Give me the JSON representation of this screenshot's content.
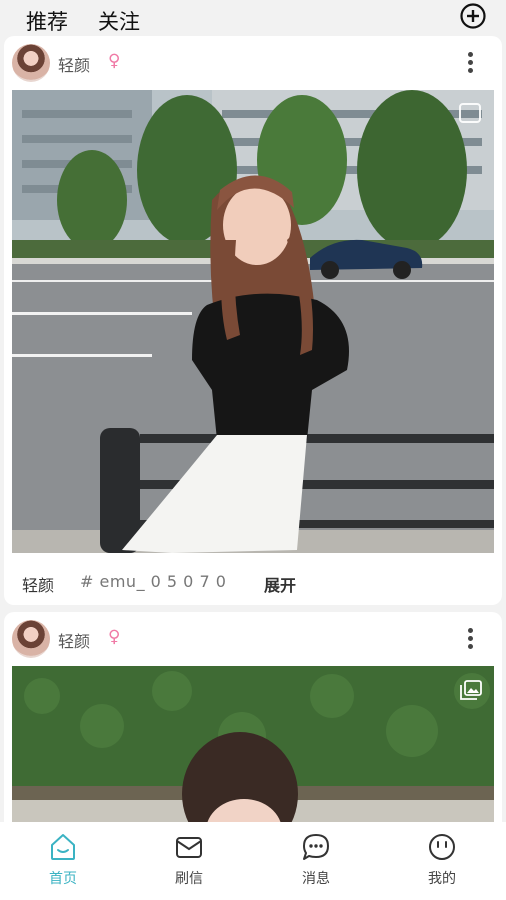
{
  "topbar": {
    "tab_recommend": "推荐",
    "tab_follow": "关注",
    "add_icon": "plus-circle-icon"
  },
  "posts": [
    {
      "username": "轻颜",
      "gender_symbol": "♀",
      "caption_name": "轻颜",
      "caption_tag": "# emu_ 0 5 0 7 0",
      "expand_label": "展开"
    },
    {
      "username": "轻颜",
      "gender_symbol": "♀"
    }
  ],
  "bottom_nav": {
    "items": [
      {
        "label": "首页",
        "icon": "home-icon",
        "active": true
      },
      {
        "label": "刷信",
        "icon": "envelope-icon",
        "active": false
      },
      {
        "label": "消息",
        "icon": "chat-bubble-icon",
        "active": false
      },
      {
        "label": "我的",
        "icon": "smiley-face-icon",
        "active": false
      }
    ]
  },
  "colors": {
    "accent": "#3bb3c3",
    "gender_pink": "#f07aa6",
    "background": "#f2f2f2"
  }
}
